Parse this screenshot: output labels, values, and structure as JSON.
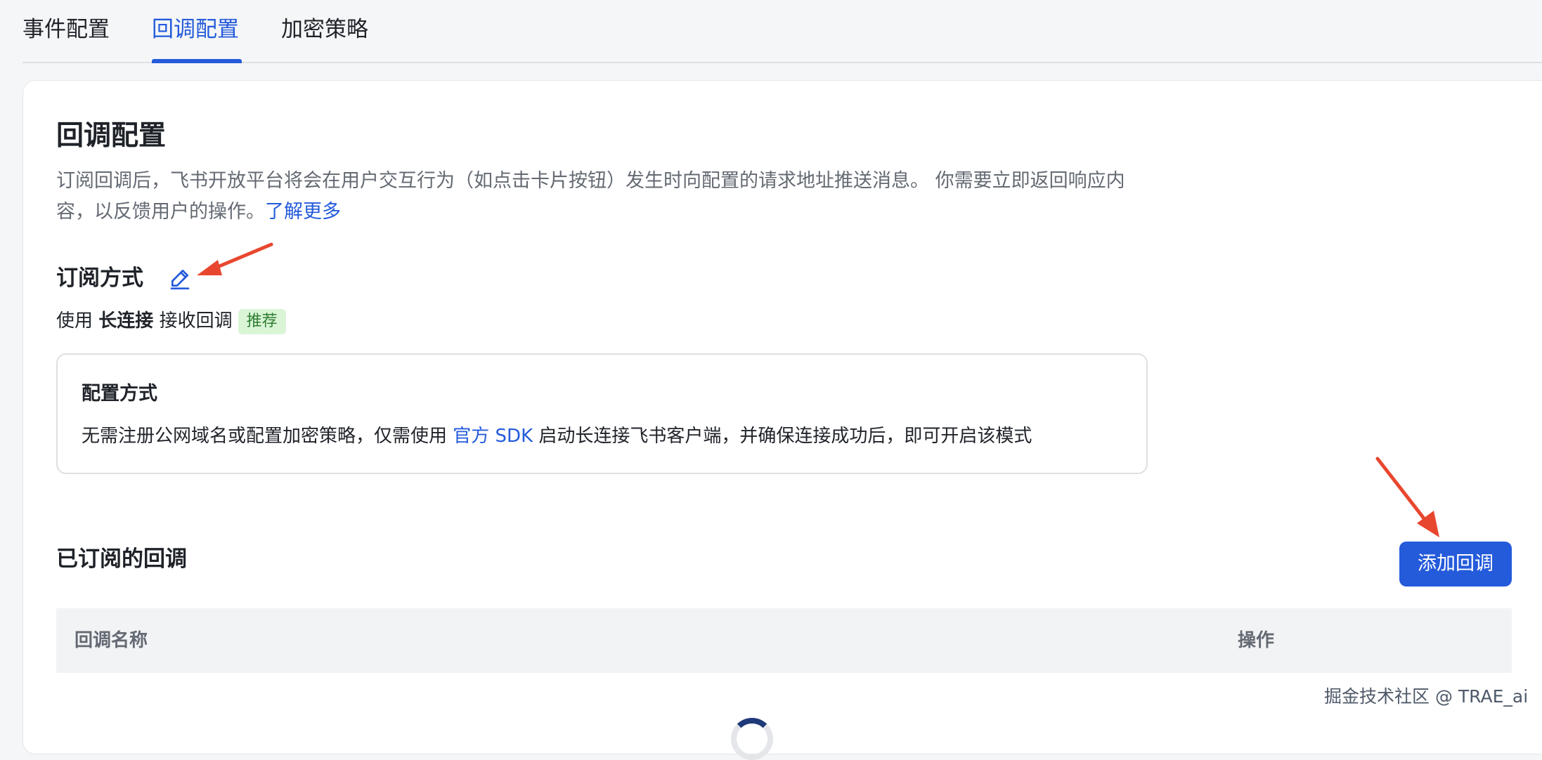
{
  "tabs": [
    {
      "label": "事件配置",
      "active": false
    },
    {
      "label": "回调配置",
      "active": true
    },
    {
      "label": "加密策略",
      "active": false
    }
  ],
  "section": {
    "title": "回调配置",
    "description_line1": "订阅回调后，飞书开放平台将会在用户交互行为（如点击卡片按钮）发生时向配置的请求地址推送消息。 你需要立即返回响应内",
    "description_line2": "容，以反馈用户的操作。",
    "learn_more": "了解更多"
  },
  "subscription": {
    "title": "订阅方式",
    "edit_icon": "pencil-icon",
    "mode_prefix": "使用",
    "mode_name": "长连接",
    "mode_suffix": "接收回调",
    "badge": "推荐"
  },
  "config_box": {
    "title": "配置方式",
    "text_before": "无需注册公网域名或配置加密策略，仅需使用",
    "link": "官方 SDK",
    "text_after": "启动长连接飞书客户端，并确保连接成功后，即可开启该模式"
  },
  "subscribed": {
    "title": "已订阅的回调",
    "add_button": "添加回调",
    "columns": [
      "回调名称",
      "操作"
    ]
  },
  "watermark": "掘金技术社区 @ TRAE_ai",
  "colors": {
    "primary": "#245bdb",
    "annotation_arrow": "#e8472f",
    "badge_bg": "#d9f5d6"
  }
}
